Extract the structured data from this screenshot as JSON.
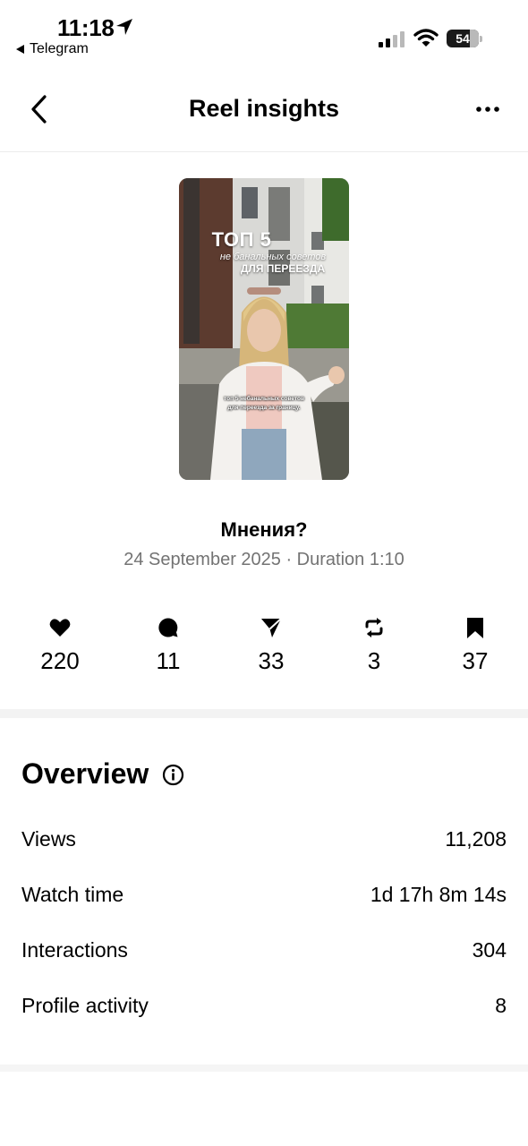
{
  "status_bar": {
    "time": "11:18",
    "back_app": "Telegram",
    "battery": "54",
    "icons": [
      "location-arrow-icon",
      "signal-icon",
      "wifi-icon",
      "battery-icon"
    ]
  },
  "header": {
    "title": "Reel insights",
    "back_icon": "chevron-left-icon",
    "more_icon": "more-horizontal-icon"
  },
  "reel": {
    "overlay_big": "ТОП 5",
    "overlay_mid": "не банальных советов",
    "overlay_small": "ДЛЯ ПЕРЕЕЗДА",
    "subtitle_line1": "топ 5 небанальных советов",
    "subtitle_line2": "для переезда за границу.",
    "title": "Мнения?",
    "meta": "24 September 2025 · Duration 1:10"
  },
  "stats": [
    {
      "icon": "heart-icon",
      "value": "220"
    },
    {
      "icon": "comment-icon",
      "value": "11"
    },
    {
      "icon": "send-icon",
      "value": "33"
    },
    {
      "icon": "repost-icon",
      "value": "3"
    },
    {
      "icon": "bookmark-icon",
      "value": "37"
    }
  ],
  "overview": {
    "title": "Overview",
    "rows": [
      {
        "label": "Views",
        "value": "11,208"
      },
      {
        "label": "Watch time",
        "value": "1d 17h 8m 14s"
      },
      {
        "label": "Interactions",
        "value": "304"
      },
      {
        "label": "Profile activity",
        "value": "8"
      }
    ]
  }
}
